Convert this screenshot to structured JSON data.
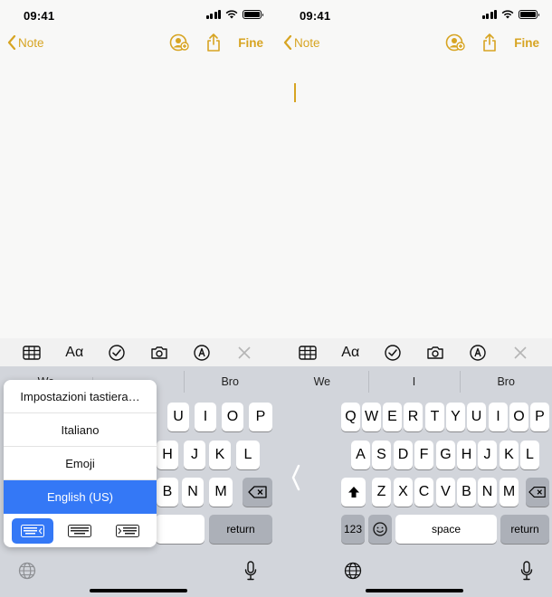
{
  "status": {
    "time": "09:41"
  },
  "nav": {
    "back_label": "Note",
    "done_label": "Fine"
  },
  "predictions": [
    "We",
    "I",
    "Bro"
  ],
  "left_predictions_visible": [
    "We",
    "",
    "Bro"
  ],
  "keyboard": {
    "row1": [
      "Q",
      "W",
      "E",
      "R",
      "T",
      "Y",
      "U",
      "I",
      "O",
      "P"
    ],
    "row2": [
      "A",
      "S",
      "D",
      "F",
      "G",
      "H",
      "J",
      "K",
      "L"
    ],
    "row3": [
      "Z",
      "X",
      "C",
      "V",
      "B",
      "N",
      "M"
    ],
    "numbers_label": "123",
    "space_label": "space",
    "return_label": "return"
  },
  "popup": {
    "items": [
      "Impostazioni tastiera…",
      "Italiano",
      "Emoji",
      "English (US)"
    ],
    "selected": "English (US)"
  },
  "colors": {
    "accent": "#d7a422",
    "selection": "#3478f6",
    "keyboard_bg": "#d2d5db"
  }
}
